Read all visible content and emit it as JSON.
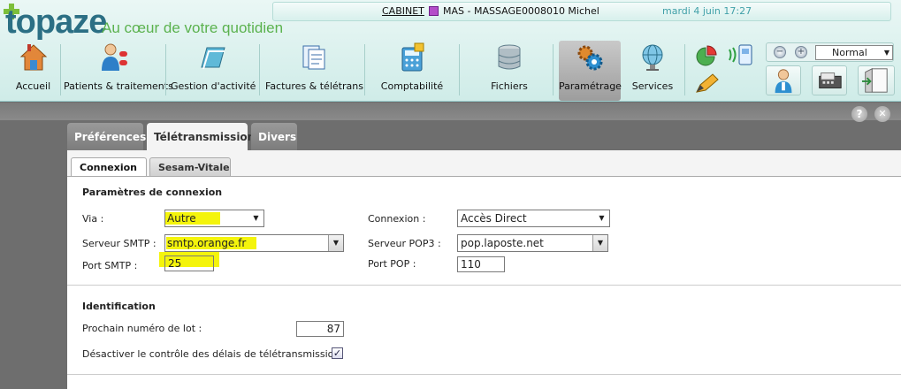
{
  "app": {
    "logo": "topaze",
    "tagline": "Au cœur de votre quotidien"
  },
  "infobar": {
    "cabinet": "CABINET",
    "practitioner": "MAS - MASSAGE0008010 Michel",
    "practitioner_color": "#b44dc9",
    "date": "mardi 4 juin 17:27"
  },
  "nav": {
    "items": [
      {
        "label": "Accueil",
        "icon": "home-icon"
      },
      {
        "label": "Patients & traitements",
        "icon": "patients-icon"
      },
      {
        "label": "Gestion d'activité",
        "icon": "folder-icon"
      },
      {
        "label": "Factures & télétrans",
        "icon": "invoice-icon"
      },
      {
        "label": "Comptabilité",
        "icon": "calculator-icon"
      },
      {
        "label": "Fichiers",
        "icon": "database-icon"
      },
      {
        "label": "Paramétrage",
        "icon": "gears-icon",
        "active": true
      },
      {
        "label": "Services",
        "icon": "globe-icon"
      }
    ]
  },
  "toolbar": {
    "zoom_value": "Normal",
    "zoom_in_glyph": "+",
    "zoom_out_glyph": "−"
  },
  "help": {
    "help_glyph": "?",
    "close_glyph": "✕"
  },
  "main_tabs": [
    {
      "label": "Préférences"
    },
    {
      "label": "Télétransmission",
      "active": true
    },
    {
      "label": "Divers"
    }
  ],
  "sub_tabs": [
    {
      "label": "Connexion",
      "active": true
    },
    {
      "label": "Sesam-Vitale"
    }
  ],
  "connection": {
    "title": "Paramètres de connexion",
    "via_label": "Via :",
    "via_value": "Autre",
    "smtp_label": "Serveur SMTP :",
    "smtp_value": "smtp.orange.fr",
    "port_smtp_label": "Port SMTP :",
    "port_smtp_value": "25",
    "connexion_label": "Connexion :",
    "connexion_value": "Accès Direct",
    "pop3_label": "Serveur POP3 :",
    "pop3_value": "pop.laposte.net",
    "port_pop_label": "Port POP :",
    "port_pop_value": "110"
  },
  "identification": {
    "title": "Identification",
    "lot_label": "Prochain numéro de lot :",
    "lot_value": "87",
    "disable_label": "Désactiver le contrôle des délais de télétransmission",
    "disable_checked": true,
    "check_glyph": "✓"
  },
  "colors": {
    "highlight": "#f4f40c",
    "accent_green": "#5bb24e",
    "brand_blue": "#2b6f84"
  }
}
